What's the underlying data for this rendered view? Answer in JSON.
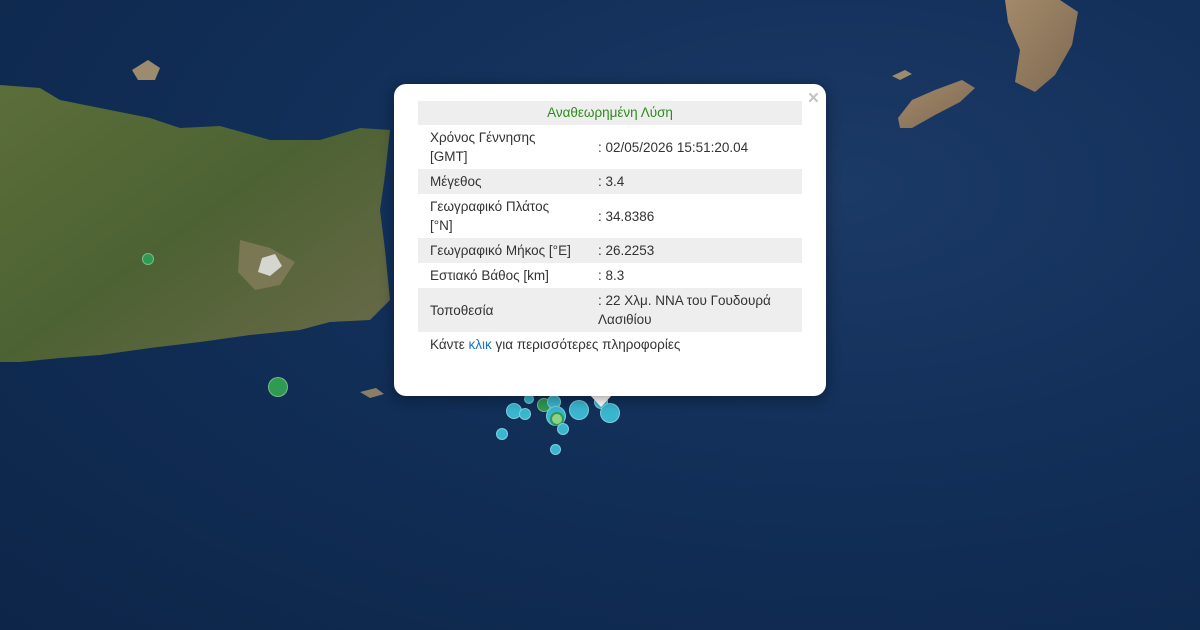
{
  "popup": {
    "title": "Αναθεωρημένη Λύση",
    "close_glyph": "×",
    "rows": [
      {
        "label": "Χρόνος Γέννησης [GMT]",
        "value": ": 02/05/2026 15:51:20.04"
      },
      {
        "label": "Μέγεθος",
        "value": ": 3.4"
      },
      {
        "label": "Γεωγραφικό Πλάτος [°N]",
        "value": ": 34.8386"
      },
      {
        "label": "Γεωγραφικό Μήκος [°E]",
        "value": ": 26.2253"
      },
      {
        "label": "Εστιακό Βάθος [km]",
        "value": ": 8.3"
      },
      {
        "label": "Τοποθεσία",
        "value": ": 22 Χλμ. ΝΝΑ του Γουδουρά Λασιθίου"
      }
    ],
    "more_prefix": "Κάντε",
    "more_link": "κλικ",
    "more_suffix": "για περισσότερες πληροφορίες"
  },
  "colors": {
    "recent_quake": "#3ab6cf",
    "older_quake": "#2e9a52",
    "title_green": "#2e8b1e",
    "link_blue": "#1a73c9"
  }
}
